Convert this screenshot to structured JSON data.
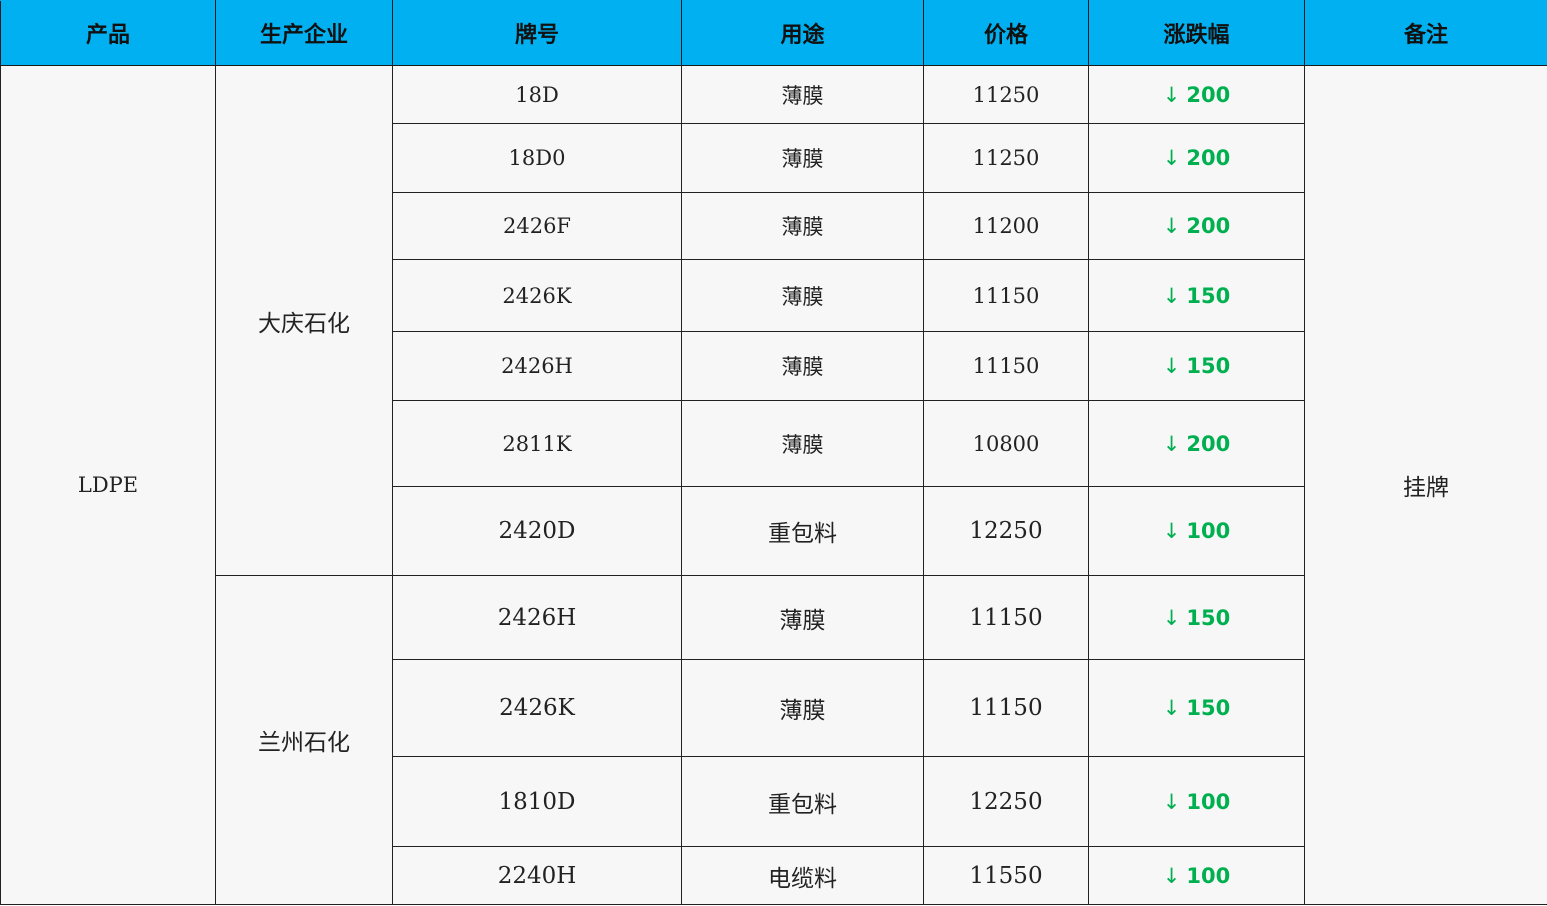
{
  "headers": [
    "产品",
    "生产企业",
    "牌号",
    "用途",
    "价格",
    "涨跌幅",
    "备注"
  ],
  "product": "LDPE",
  "remark": "挂牌",
  "change_color": "#00b050",
  "header_color": "#00b0f0",
  "groups": [
    {
      "company": "大庆石化",
      "rows": [
        {
          "grade": "18D",
          "use": "薄膜",
          "price": "11250",
          "change": "200",
          "direction": "down"
        },
        {
          "grade": "18D0",
          "use": "薄膜",
          "price": "11250",
          "change": "200",
          "direction": "down"
        },
        {
          "grade": "2426F",
          "use": "薄膜",
          "price": "11200",
          "change": "200",
          "direction": "down"
        },
        {
          "grade": "2426K",
          "use": "薄膜",
          "price": "11150",
          "change": "150",
          "direction": "down"
        },
        {
          "grade": "2426H",
          "use": "薄膜",
          "price": "11150",
          "change": "150",
          "direction": "down"
        },
        {
          "grade": "2811K",
          "use": "薄膜",
          "price": "10800",
          "change": "200",
          "direction": "down"
        },
        {
          "grade": "2420D",
          "use": "重包料",
          "price": "12250",
          "change": "100",
          "direction": "down"
        }
      ]
    },
    {
      "company": "兰州石化",
      "rows": [
        {
          "grade": "2426H",
          "use": "薄膜",
          "price": "11150",
          "change": "150",
          "direction": "down"
        },
        {
          "grade": "2426K",
          "use": "薄膜",
          "price": "11150",
          "change": "150",
          "direction": "down"
        },
        {
          "grade": "1810D",
          "use": "重包料",
          "price": "12250",
          "change": "100",
          "direction": "down"
        },
        {
          "grade": "2240H",
          "use": "电缆料",
          "price": "11550",
          "change": "100",
          "direction": "down"
        }
      ]
    }
  ]
}
